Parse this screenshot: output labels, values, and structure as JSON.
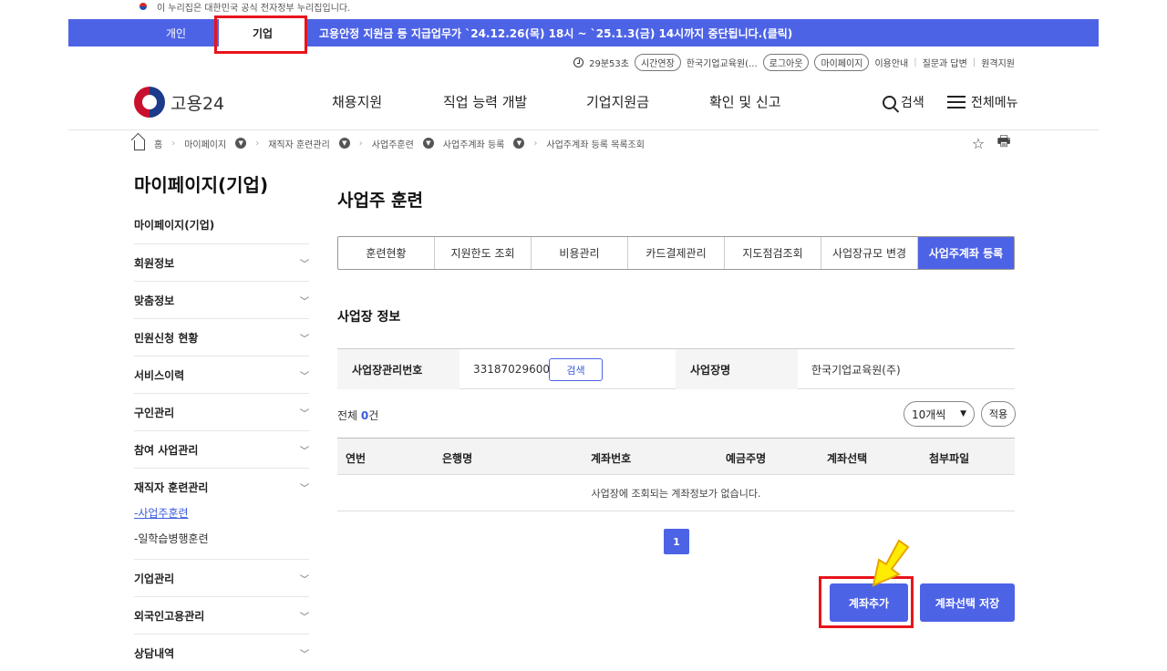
{
  "gov_banner": {
    "text": "이 누리집은 대한민국 공식 전자정부 누리집입니다."
  },
  "notice_bar": {
    "tab_personal": "개인",
    "tab_company": "기업",
    "message": "고용안정 지원금 등 지급업무가 `24.12.26(목) 18시 ~ `25.1.3(금) 14시까지 중단됩니다.(클릭)"
  },
  "utility": {
    "timer": "29분53초",
    "extend": "시간연장",
    "org_name": "한국기업교육원(...",
    "logout": "로그아웃",
    "mypage": "마이페이지",
    "guide": "이용안내",
    "qna": "질문과 답변",
    "remote": "원격지원"
  },
  "header": {
    "logo_text": "고용24",
    "nav": [
      "채용지원",
      "직업 능력 개발",
      "기업지원금",
      "확인 및 신고"
    ],
    "search_label": "검색",
    "menu_label": "전체메뉴"
  },
  "breadcrumb": [
    "홈",
    "마이페이지",
    "재직자 훈련관리",
    "사업주훈련",
    "사업주계좌 등록",
    "사업주계좌 등록 목록조회"
  ],
  "sidebar": {
    "title": "마이페이지(기업)",
    "subtitle": "마이페이지(기업)",
    "items": [
      "회원정보",
      "맞춤정보",
      "민원신청 현황",
      "서비스이력",
      "구인관리",
      "참여 사업관리",
      "재직자 훈련관리",
      "기업관리",
      "외국인고용관리",
      "상담내역"
    ],
    "children": [
      "사업주훈련",
      "일학습병행훈련"
    ]
  },
  "main": {
    "title": "사업주 훈련",
    "tabs": [
      "훈련현황",
      "지원한도 조회",
      "비용관리",
      "카드결제관리",
      "지도점검조회",
      "사업장규모 변경",
      "사업주계좌 등록"
    ],
    "section_title": "사업장 정보",
    "info": {
      "mgmt_no_label": "사업장관리번호",
      "mgmt_no_value": "33187029600",
      "search_btn": "검색",
      "name_label": "사업장명",
      "name_value": "한국기업교육원(주)"
    },
    "total_prefix": "전체 ",
    "total_count": "0",
    "total_suffix": "건",
    "page_size": "10개씩",
    "apply": "적용",
    "columns": [
      "연번",
      "은행명",
      "계좌번호",
      "예금주명",
      "계좌선택",
      "첨부파일"
    ],
    "empty_message": "사업장에 조회되는 계좌정보가 없습니다.",
    "page": "1",
    "add_account": "계좌추가",
    "save_selection": "계좌선택 저장"
  }
}
